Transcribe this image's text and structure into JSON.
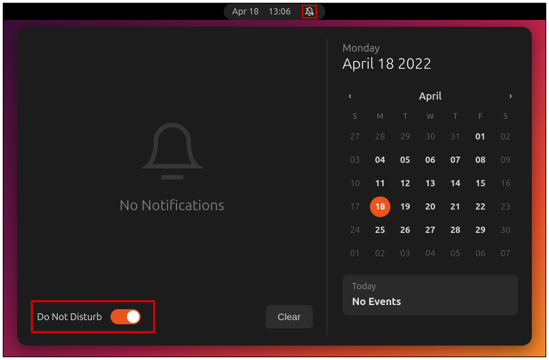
{
  "topbar": {
    "date": "Apr 18",
    "time": "13:06"
  },
  "notifications": {
    "empty_message": "No Notifications",
    "dnd_label": "Do Not Disturb",
    "dnd_on": true,
    "clear_label": "Clear"
  },
  "calendar": {
    "day_name": "Monday",
    "full_date": "April 18 2022",
    "month_label": "April",
    "weekdays": [
      "S",
      "M",
      "T",
      "W",
      "T",
      "F",
      "S"
    ],
    "weeks": [
      [
        {
          "d": 27,
          "dim": true
        },
        {
          "d": 28,
          "dim": true
        },
        {
          "d": 29,
          "dim": true
        },
        {
          "d": 30,
          "dim": true
        },
        {
          "d": 31,
          "dim": true
        },
        {
          "d": 1
        },
        {
          "d": 2,
          "dim": true
        }
      ],
      [
        {
          "d": 3,
          "dim": true
        },
        {
          "d": 4
        },
        {
          "d": 5
        },
        {
          "d": 6
        },
        {
          "d": 7
        },
        {
          "d": 8
        },
        {
          "d": 9,
          "dim": true
        }
      ],
      [
        {
          "d": 10,
          "dim": true
        },
        {
          "d": 11
        },
        {
          "d": 12
        },
        {
          "d": 13
        },
        {
          "d": 14
        },
        {
          "d": 15
        },
        {
          "d": 16,
          "dim": true
        }
      ],
      [
        {
          "d": 17,
          "dim": true
        },
        {
          "d": 18,
          "today": true
        },
        {
          "d": 19
        },
        {
          "d": 20
        },
        {
          "d": 21
        },
        {
          "d": 22
        },
        {
          "d": 23,
          "dim": true
        }
      ],
      [
        {
          "d": 24,
          "dim": true
        },
        {
          "d": 25
        },
        {
          "d": 26
        },
        {
          "d": 27
        },
        {
          "d": 28
        },
        {
          "d": 29
        },
        {
          "d": 30,
          "dim": true
        }
      ],
      [
        {
          "d": 1,
          "dim": true
        },
        {
          "d": 2,
          "dim": true
        },
        {
          "d": 3,
          "dim": true
        },
        {
          "d": 4,
          "dim": true
        },
        {
          "d": 5,
          "dim": true
        },
        {
          "d": 6,
          "dim": true
        },
        {
          "d": 7,
          "dim": true
        }
      ]
    ]
  },
  "events": {
    "header": "Today",
    "body": "No Events"
  }
}
